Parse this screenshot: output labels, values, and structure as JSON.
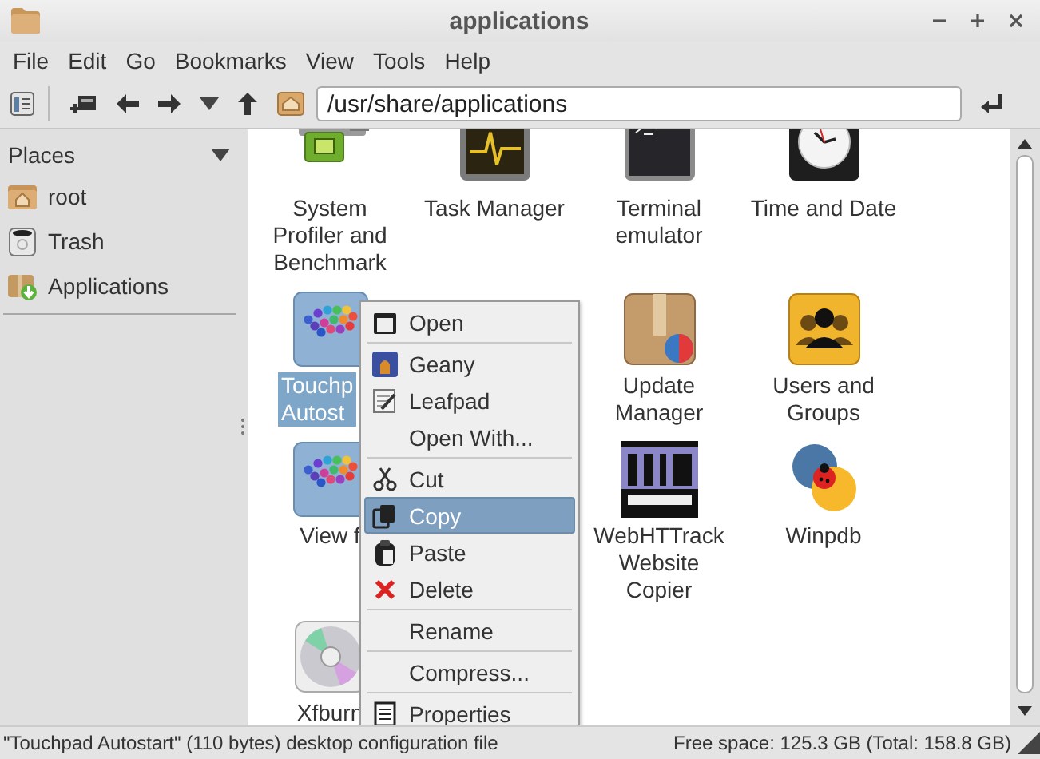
{
  "window": {
    "title": "applications"
  },
  "menu_bar": [
    "File",
    "Edit",
    "Go",
    "Bookmarks",
    "View",
    "Tools",
    "Help"
  ],
  "location": {
    "value": "/usr/share/applications"
  },
  "sidebar": {
    "title": "Places",
    "items": [
      {
        "label": "root",
        "selected": false
      },
      {
        "label": "Trash",
        "selected": false
      },
      {
        "label": "Applications",
        "selected": false
      }
    ]
  },
  "icon_view": {
    "rows": [
      {
        "items": [
          {
            "kind": "app",
            "label": "System Profiler and Benchmark",
            "selected": false
          },
          {
            "kind": "app",
            "label": "Task Manager",
            "selected": false
          },
          {
            "kind": "app",
            "label": "Terminal emulator",
            "selected": false
          },
          {
            "kind": "app",
            "label": "Time and Date",
            "selected": false
          }
        ]
      },
      {
        "items": [
          {
            "kind": "app",
            "label": "Touchp\nAutost",
            "selected": true
          },
          {
            "kind": "covered"
          },
          {
            "kind": "app",
            "label": "Update Manager",
            "selected": false
          },
          {
            "kind": "app",
            "label": "Users and Groups",
            "selected": false
          }
        ]
      },
      {
        "items": [
          {
            "kind": "app",
            "label": "View f",
            "selected": false
          },
          {
            "kind": "covered"
          },
          {
            "kind": "app",
            "label": "WebHTTrack Website Copier",
            "selected": false
          },
          {
            "kind": "app",
            "label": "Winpdb",
            "selected": false
          }
        ]
      },
      {
        "items": [
          {
            "kind": "app",
            "label": "Xfburn",
            "selected": false
          }
        ]
      }
    ]
  },
  "context_menu": {
    "groups": [
      [
        {
          "label": "Open",
          "selected": false
        }
      ],
      [
        {
          "label": "Geany",
          "selected": false
        },
        {
          "label": "Leafpad",
          "selected": false
        },
        {
          "label": "Open With...",
          "selected": false
        }
      ],
      [
        {
          "label": "Cut",
          "selected": false
        },
        {
          "label": "Copy",
          "selected": true
        },
        {
          "label": "Paste",
          "selected": false
        },
        {
          "label": "Delete",
          "selected": false
        }
      ],
      [
        {
          "label": "Rename",
          "selected": false
        }
      ],
      [
        {
          "label": "Compress...",
          "selected": false
        }
      ],
      [
        {
          "label": "Properties",
          "selected": false
        }
      ]
    ]
  },
  "status_bar": {
    "left": "\"Touchpad Autostart\" (110 bytes) desktop configuration file",
    "right": "Free space: 125.3 GB (Total: 158.8 GB)"
  }
}
